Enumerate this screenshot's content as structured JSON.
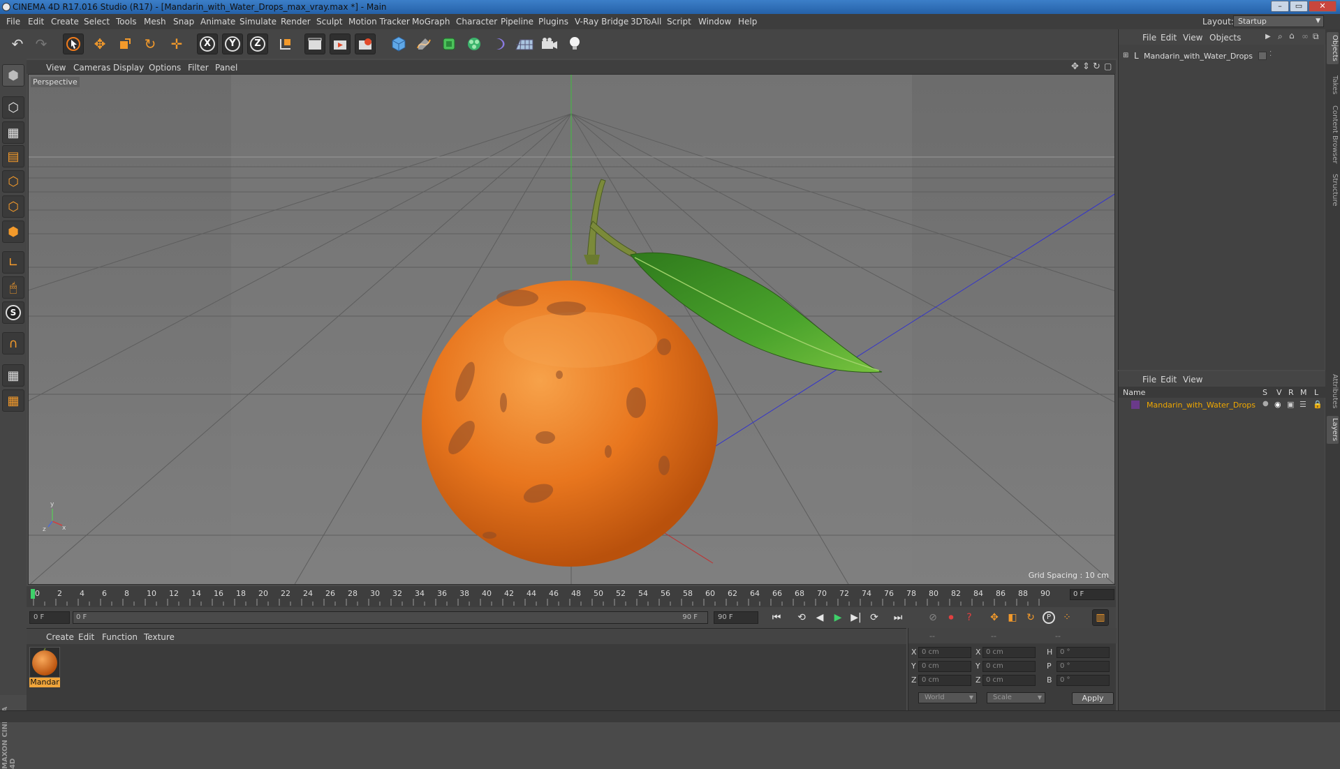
{
  "window": {
    "title": "CINEMA 4D R17.016 Studio (R17) - [Mandarin_with_Water_Drops_max_vray.max *] - Main",
    "buttons": [
      "–",
      "▭",
      "✕"
    ]
  },
  "menu": {
    "items": [
      "File",
      "Edit",
      "Create",
      "Select",
      "Tools",
      "Mesh",
      "Snap",
      "Animate",
      "Simulate",
      "Render",
      "Sculpt",
      "Motion Tracker",
      "MoGraph",
      "Character",
      "Pipeline",
      "Plugins",
      "V-Ray Bridge",
      "3DToAll",
      "Script",
      "Window",
      "Help"
    ],
    "layout_label": "Layout:",
    "layout_value": "Startup"
  },
  "toolbar": {
    "axis_x": "X",
    "axis_y": "Y",
    "axis_z": "Z"
  },
  "viewport": {
    "menu": [
      "View",
      "Cameras",
      "Display",
      "Options",
      "Filter",
      "Panel"
    ],
    "label": "Perspective",
    "grid_spacing": "Grid Spacing : 10 cm"
  },
  "timeline": {
    "ticks": [
      "0",
      "2",
      "4",
      "6",
      "8",
      "10",
      "12",
      "14",
      "16",
      "18",
      "20",
      "22",
      "24",
      "26",
      "28",
      "30",
      "32",
      "34",
      "36",
      "38",
      "40",
      "42",
      "44",
      "46",
      "48",
      "50",
      "52",
      "54",
      "56",
      "58",
      "60",
      "62",
      "64",
      "66",
      "68",
      "70",
      "72",
      "74",
      "76",
      "78",
      "80",
      "82",
      "84",
      "86",
      "88",
      "90"
    ],
    "current_frame": "0 F"
  },
  "transport": {
    "start_field": "0 F",
    "range_start": "0 F",
    "range_end": "90 F",
    "end_field": "90 F"
  },
  "materials": {
    "menu": [
      "Create",
      "Edit",
      "Function",
      "Texture"
    ],
    "items": [
      {
        "name": "Mandar"
      }
    ]
  },
  "coordinates": {
    "headers": [
      "--",
      "--",
      "--"
    ],
    "rows": [
      {
        "a": "X",
        "av": "0 cm",
        "b": "X",
        "bv": "0 cm",
        "c": "H",
        "cv": "0 °"
      },
      {
        "a": "Y",
        "av": "0 cm",
        "b": "Y",
        "bv": "0 cm",
        "c": "P",
        "cv": "0 °"
      },
      {
        "a": "Z",
        "av": "0 cm",
        "b": "Z",
        "bv": "0 cm",
        "c": "B",
        "cv": "0 °"
      }
    ],
    "space": "World",
    "mode": "Scale",
    "apply": "Apply"
  },
  "objects_panel": {
    "menu": [
      "File",
      "Edit",
      "View",
      "Objects"
    ],
    "object_name": "Mandarin_with_Water_Drops"
  },
  "layers_panel": {
    "menu": [
      "File",
      "Edit",
      "View"
    ],
    "header_name": "Name",
    "header_cols": [
      "S",
      "V",
      "R",
      "M",
      "L"
    ],
    "layer_name": "Mandarin_with_Water_Drops"
  },
  "right_tabs": [
    "Objects",
    "Takes",
    "Content Browser",
    "Structure",
    "Attributes",
    "Layers"
  ],
  "brand": "MAXON CINEMA 4D",
  "colors": {
    "accent_orange": "#f0a53b",
    "layer_name": "#f0a800",
    "viewport_bg": "#7a7a7a",
    "mandarin": "#e8761e",
    "leaf": "#3f8f25"
  }
}
